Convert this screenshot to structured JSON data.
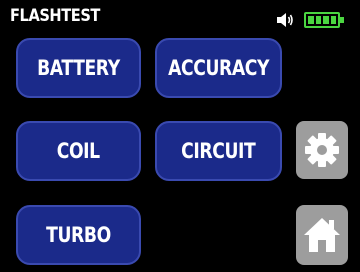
{
  "header": {
    "title": "FLASHTEST",
    "speaker_icon": "speaker-icon",
    "battery_icon": "battery-full-icon",
    "battery_level": 1.0
  },
  "menu": {
    "battery_label": "BATTERY",
    "accuracy_label": "ACCURACY",
    "coil_label": "COIL",
    "circuit_label": "CIRCUIT",
    "turbo_label": "TURBO"
  },
  "side": {
    "settings_icon": "gear-icon",
    "home_icon": "home-icon"
  },
  "colors": {
    "background": "#000000",
    "button_fill": "#1b2a8a",
    "button_border": "#3a4ab0",
    "icon_button_fill": "#9d9d9d",
    "battery_green": "#4bd641"
  }
}
